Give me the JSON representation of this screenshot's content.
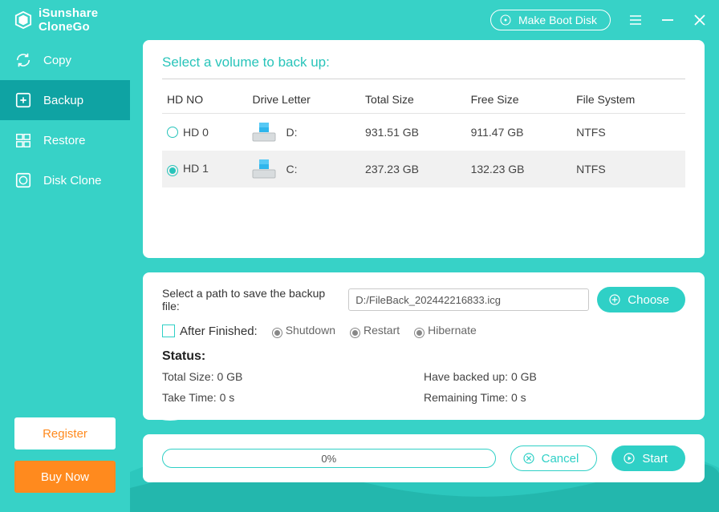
{
  "app": {
    "name_line1": "iSunshare",
    "name_line2": "CloneGo"
  },
  "titlebar": {
    "boot_label": "Make Boot Disk"
  },
  "sidebar": {
    "items": [
      {
        "label": "Copy"
      },
      {
        "label": "Backup"
      },
      {
        "label": "Restore"
      },
      {
        "label": "Disk Clone"
      }
    ],
    "register_label": "Register",
    "buy_label": "Buy Now"
  },
  "volumes": {
    "title": "Select a volume to back up:",
    "headers": {
      "hdno": "HD NO",
      "drive": "Drive Letter",
      "total": "Total Size",
      "free": "Free Size",
      "fs": "File System"
    },
    "rows": [
      {
        "hdno": "HD 0",
        "drive": "D:",
        "total": "931.51 GB",
        "free": "911.47 GB",
        "fs": "NTFS",
        "selected": false
      },
      {
        "hdno": "HD 1",
        "drive": "C:",
        "total": "237.23 GB",
        "free": "132.23 GB",
        "fs": "NTFS",
        "selected": true
      }
    ]
  },
  "options": {
    "path_label": "Select a path to save the backup file:",
    "path_value": "D:/FileBack_202442216833.icg",
    "choose_label": "Choose",
    "after_label": "After Finished:",
    "after_opts": {
      "shutdown": "Shutdown",
      "restart": "Restart",
      "hibernate": "Hibernate"
    }
  },
  "status": {
    "title": "Status:",
    "total_label": "Total Size: ",
    "total_value": "0 GB",
    "backed_label": "Have backed up: ",
    "backed_value": "0 GB",
    "time_label": "Take Time: ",
    "time_value": "0 s",
    "remain_label": "Remaining Time: ",
    "remain_value": "0 s"
  },
  "progress": {
    "percent_text": "0%",
    "cancel_label": "Cancel",
    "start_label": "Start"
  }
}
